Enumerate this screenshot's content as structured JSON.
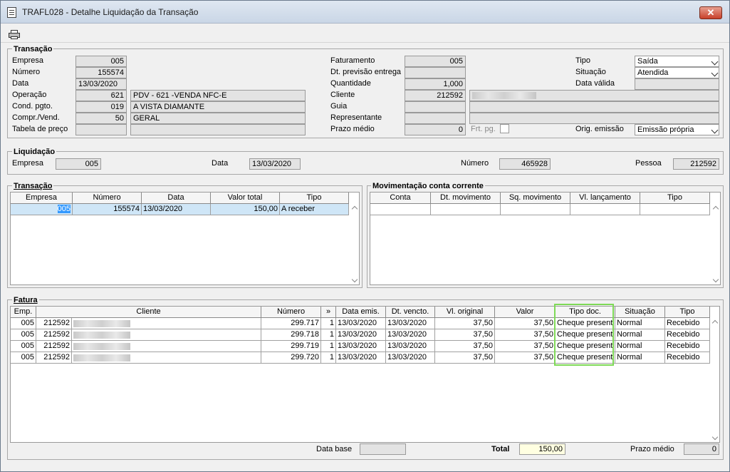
{
  "window": {
    "title": "TRAFL028 - Detalhe Liquidação da Transação",
    "close": "✕"
  },
  "transacao": {
    "title": "Transação",
    "empresa_label": "Empresa",
    "empresa": "005",
    "numero_label": "Número",
    "numero": "155574",
    "data_label": "Data",
    "data": "13/03/2020",
    "operacao_label": "Operação",
    "operacao_code": "621",
    "operacao_desc": "PDV - 621 -VENDA NFC-E",
    "cond_label": "Cond. pgto.",
    "cond_code": "019",
    "cond_desc": "A VISTA DIAMANTE",
    "compr_label": "Compr./Vend.",
    "compr_code": "50",
    "compr_desc": "GERAL",
    "tabela_label": "Tabela de preço",
    "faturamento_label": "Faturamento",
    "faturamento": "005",
    "previsao_label": "Dt. previsão entrega",
    "quantidade_label": "Quantidade",
    "quantidade": "1,000",
    "cliente_label": "Cliente",
    "cliente_code": "212592",
    "guia_label": "Guia",
    "representante_label": "Representante",
    "prazo_label": "Prazo médio",
    "prazo": "0",
    "frt_label": "Frt. pg.",
    "tipo_label": "Tipo",
    "tipo": "Saída",
    "situacao_label": "Situação",
    "situacao": "Atendida",
    "data_valida_label": "Data válida",
    "orig_label": "Orig. emissão",
    "orig": "Emissão própria"
  },
  "liquidacao": {
    "title": "Liquidação",
    "empresa_label": "Empresa",
    "empresa": "005",
    "data_label": "Data",
    "data": "13/03/2020",
    "numero_label": "Número",
    "numero": "465928",
    "pessoa_label": "Pessoa",
    "pessoa": "212592"
  },
  "transacao_grid": {
    "title": "Transação",
    "headers": [
      "Empresa",
      "Número",
      "Data",
      "Valor total",
      "Tipo"
    ],
    "rows": [
      [
        "005",
        "155574",
        "13/03/2020",
        "150,00",
        "A receber"
      ]
    ]
  },
  "movimentacao_grid": {
    "title": "Movimentação conta corrente",
    "headers": [
      "Conta",
      "Dt. movimento",
      "Sq. movimento",
      "Vl. lançamento",
      "Tipo"
    ]
  },
  "fatura_grid": {
    "title": "Fatura",
    "headers": [
      "Emp.",
      "Cliente",
      "Número",
      "»",
      "Data emis.",
      "Dt. vencto.",
      "Vl. original",
      "Valor",
      "Tipo doc.",
      "Situação",
      "Tipo"
    ],
    "rows": [
      [
        "005",
        "212592",
        "299.717",
        "1",
        "13/03/2020",
        "13/03/2020",
        "37,50",
        "37,50",
        "Cheque present",
        "Normal",
        "Recebido"
      ],
      [
        "005",
        "212592",
        "299.718",
        "1",
        "13/03/2020",
        "13/03/2020",
        "37,50",
        "37,50",
        "Cheque present",
        "Normal",
        "Recebido"
      ],
      [
        "005",
        "212592",
        "299.719",
        "1",
        "13/03/2020",
        "13/03/2020",
        "37,50",
        "37,50",
        "Cheque present",
        "Normal",
        "Recebido"
      ],
      [
        "005",
        "212592",
        "299.720",
        "1",
        "13/03/2020",
        "13/03/2020",
        "37,50",
        "37,50",
        "Cheque present",
        "Normal",
        "Recebido"
      ]
    ]
  },
  "footer": {
    "data_base_label": "Data base",
    "total_label": "Total",
    "total": "150,00",
    "prazo_label": "Prazo médio",
    "prazo": "0"
  }
}
